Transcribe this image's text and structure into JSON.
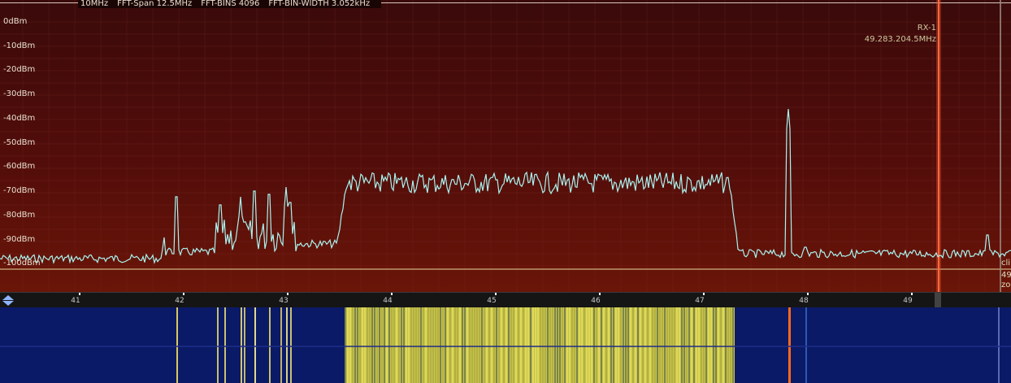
{
  "fft_info": {
    "span_fragment": "10MHz",
    "fft_span": "FFT-Span 12.5MHz",
    "fft_bins": "FFT-BINS 4096",
    "fft_bin_width": "FFT-BIN-WIDTH 3.052kHz"
  },
  "db_scale": [
    "0dBm",
    "-10dBm",
    "-20dBm",
    "-30dBm",
    "-40dBm",
    "-50dBm",
    "-60dBm",
    "-70dBm",
    "-80dBm",
    "-90dBm",
    "-100dBm"
  ],
  "receiver": {
    "name": "RX-1",
    "frequency": "49.283.204.5MHz"
  },
  "right_edge_fragments": [
    "cli",
    "49",
    "zoom"
  ],
  "freq_axis": {
    "ticks": [
      "41",
      "42",
      "43",
      "44",
      "45",
      "46",
      "47",
      "48",
      "49"
    ]
  },
  "colors": {
    "spectrum_trace": "#a8f4f0",
    "rx_marker": "#ff6a3a",
    "waterfall_signal": "#d8d450",
    "waterfall_background": "#0b1a66"
  },
  "icons": {
    "zoom_control": "up-down-arrows-icon"
  }
}
